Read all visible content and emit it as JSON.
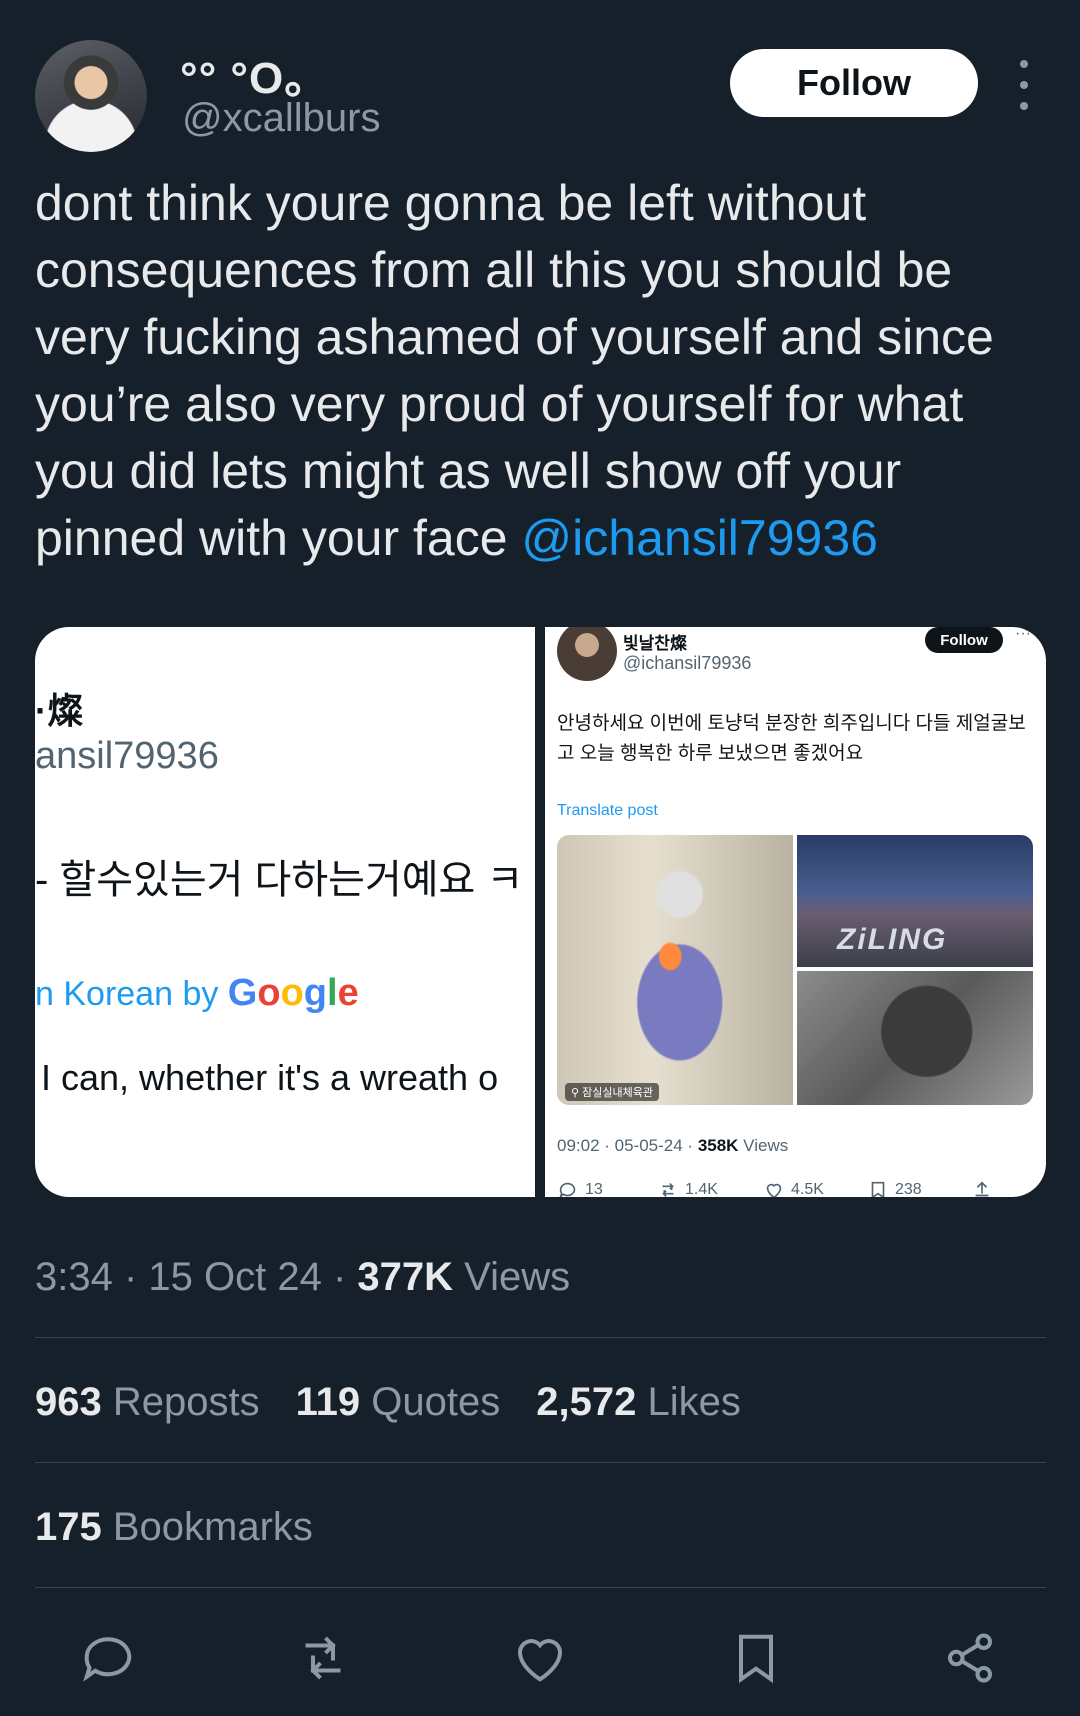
{
  "author": {
    "display_name": "°° °O。",
    "handle": "@xcallburs",
    "follow_label": "Follow"
  },
  "tweet": {
    "text": "dont think youre gonna be left without consequences from all this you should be very fucking ashamed of yourself and since you’re also very proud of yourself for what you did lets might as well show off your pinned with your face ",
    "mention": "@ichansil79936"
  },
  "media_left": {
    "name_fragment": "·燦",
    "handle_fragment": "ansil79936",
    "korean_fragment": "- 할수있는거 다하는거예요 ㅋ",
    "translated_prefix": "n Korean by ",
    "google": "Google",
    "english_fragment": "I can, whether it's a wreath o"
  },
  "media_right": {
    "name": "빛날찬燦",
    "handle": "@ichansil79936",
    "follow_label": "Follow",
    "more": "···",
    "text": "안녕하세요 이번에 토냥덕 분장한 희주입니다 다들 제얼굴보고 오늘 행복한 하루 보냈으면 좋겠어요",
    "translate_label": "Translate post",
    "image_location": "⚲ 잠실실내체육관",
    "image_overlay_text": "ZiLING",
    "time": "09:02 · 05-05-24 · ",
    "views_num": "358K",
    "views_label": " Views",
    "replies": "13",
    "reposts": "1.4K",
    "likes": "4.5K",
    "bookmarks": "238"
  },
  "meta": {
    "time": "3:34 · 15 Oct 24 · ",
    "views_num": "377K",
    "views_label": " Views"
  },
  "stats": {
    "reposts_num": "963",
    "reposts_label": " Reposts",
    "quotes_num": "119",
    "quotes_label": " Quotes",
    "likes_num": "2,572",
    "likes_label": " Likes",
    "bookmarks_num": "175",
    "bookmarks_label": " Bookmarks"
  },
  "actions": [
    "reply-icon",
    "repost-icon",
    "like-icon",
    "bookmark-icon",
    "share-icon"
  ],
  "colors": {
    "background": "#15202b",
    "accent": "#1d9bf0",
    "muted": "#8b98a5"
  }
}
